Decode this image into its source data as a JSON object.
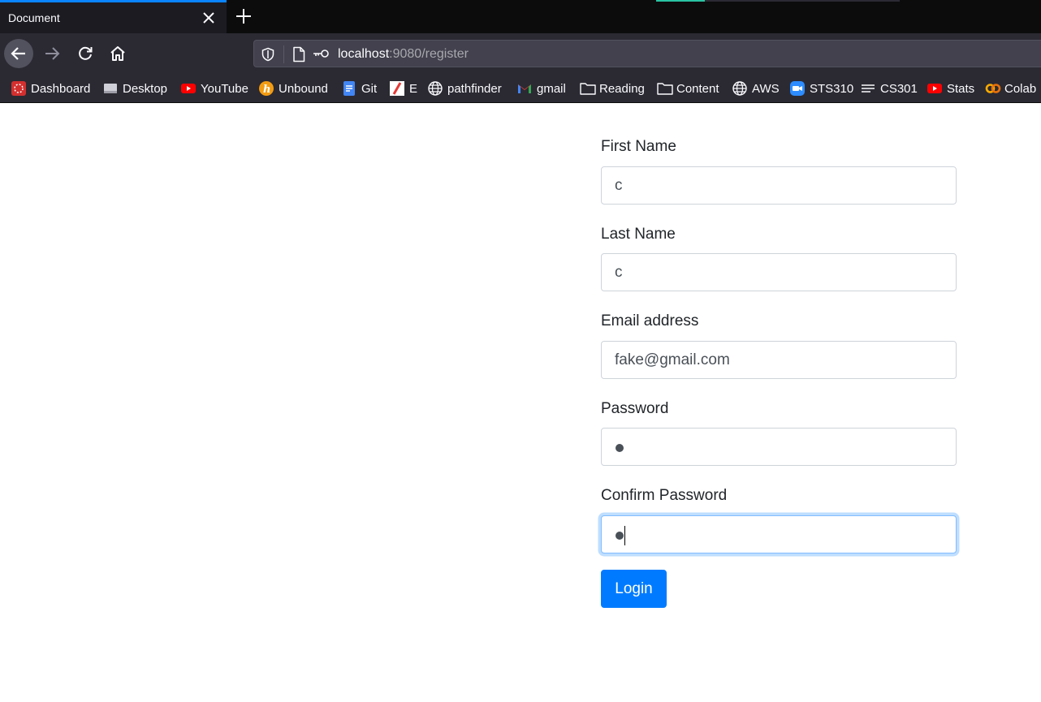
{
  "browser": {
    "tab_title": "Document",
    "url_host": "localhost",
    "url_path": ":9080/register",
    "bookmarks": [
      {
        "label": "Dashboard",
        "icon": "dashboard-icon"
      },
      {
        "label": "Desktop",
        "icon": "desktop-icon"
      },
      {
        "label": "YouTube",
        "icon": "youtube-icon"
      },
      {
        "label": "Unbound",
        "icon": "unbound-icon"
      },
      {
        "label": "Git",
        "icon": "docs-icon"
      },
      {
        "label": "E",
        "icon": "e-icon"
      },
      {
        "label": "pathfinder",
        "icon": "globe-icon"
      },
      {
        "label": "gmail",
        "icon": "gmail-icon"
      },
      {
        "label": "Reading",
        "icon": "folder-icon"
      },
      {
        "label": "Content",
        "icon": "folder-icon"
      },
      {
        "label": "AWS",
        "icon": "globe-icon"
      },
      {
        "label": "STS310",
        "icon": "zoom-icon"
      },
      {
        "label": "CS301",
        "icon": "lines-icon"
      },
      {
        "label": "Stats",
        "icon": "youtube-icon"
      },
      {
        "label": "Colab",
        "icon": "colab-icon"
      }
    ]
  },
  "form": {
    "first_name": {
      "label": "First Name",
      "value": "c"
    },
    "last_name": {
      "label": "Last Name",
      "value": "c"
    },
    "email": {
      "label": "Email address",
      "value": "fake@gmail.com"
    },
    "password": {
      "label": "Password"
    },
    "confirm_password": {
      "label": "Confirm Password"
    },
    "submit_label": "Login"
  },
  "colors": {
    "primary": "#007bff",
    "chrome_dark": "#2b2a33",
    "tab_accent": "#0a84ff"
  }
}
